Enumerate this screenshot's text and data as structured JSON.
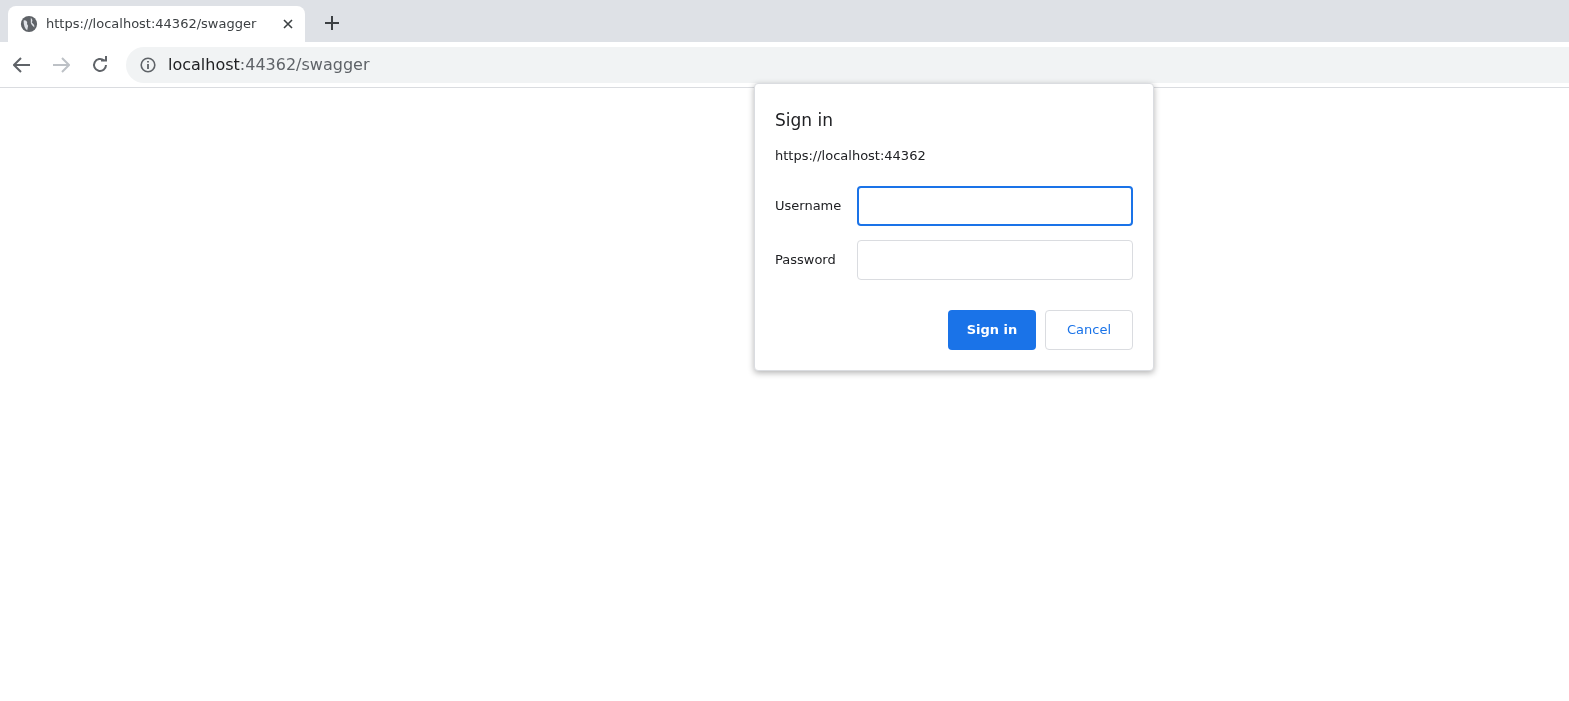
{
  "tabs": [
    {
      "title": "https://localhost:44362/swagger",
      "selected": true
    }
  ],
  "address_bar": {
    "host": "localhost",
    "path": ":44362/swagger"
  },
  "nav": {
    "forward_disabled": true
  },
  "dialog": {
    "title": "Sign in",
    "origin": "https://localhost:44362",
    "fields": [
      {
        "label": "Username",
        "focused": true
      },
      {
        "label": "Password",
        "focused": false
      }
    ],
    "buttons": [
      {
        "label": "Sign in",
        "kind": "primary"
      },
      {
        "label": "Cancel",
        "kind": "secondary"
      }
    ]
  }
}
